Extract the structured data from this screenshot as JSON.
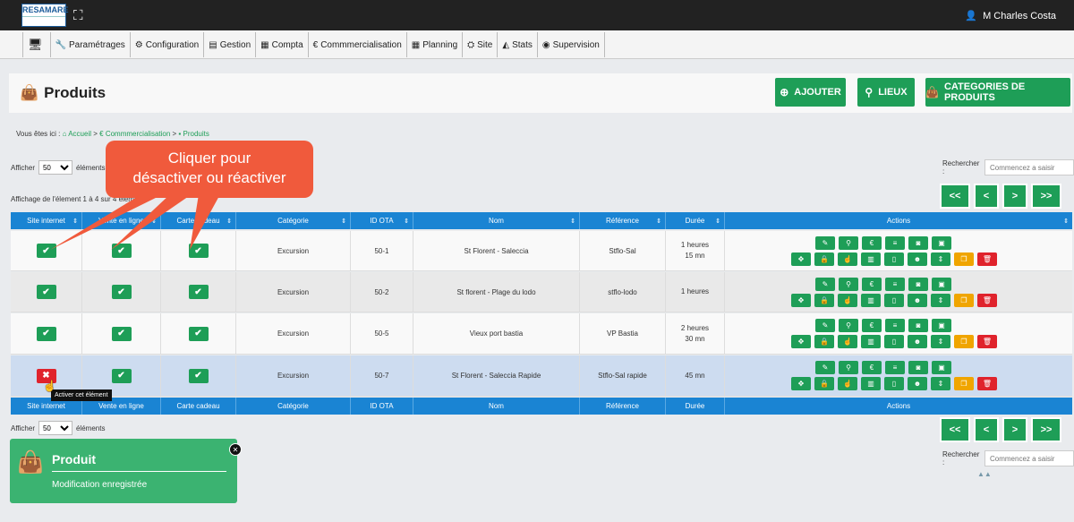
{
  "app": {
    "logo_text": "RESAMARE",
    "user": "M Charles Costa"
  },
  "menu": [
    "Paramétrages",
    "Configuration",
    "Gestion",
    "Compta",
    "Commmercialisation",
    "Planning",
    "Site",
    "Stats",
    "Supervision"
  ],
  "page": {
    "title": "Produits"
  },
  "buttons": {
    "add": "AJOUTER",
    "places": "LIEUX",
    "categories": "CATEGORIES DE PRODUITS"
  },
  "breadcrumb": {
    "prefix": "Vous êtes ici :",
    "home": "Accueil",
    "section": "Commmercialisation",
    "current": "Produits"
  },
  "list": {
    "show_label": "Afficher",
    "page_size": "50",
    "items_label": "éléments",
    "search_label": "Rechercher :",
    "search_placeholder": "Commencez a saisir",
    "info": "Affichage de l'élement 1 à 4 sur 4 éléments"
  },
  "pager": {
    "first": "<<",
    "prev": "<",
    "next": ">",
    "last": ">>"
  },
  "columns": [
    "Site internet",
    "Vente en ligne",
    "Carte cadeau",
    "Catégorie",
    "ID OTA",
    "Nom",
    "Référence",
    "Durée",
    "Actions"
  ],
  "rows": [
    {
      "site": true,
      "vente": true,
      "carte": true,
      "categorie": "Excursion",
      "id": "50-1",
      "nom": "St Florent - Saleccia",
      "ref": "Stflo-Sal",
      "duree1": "1 heures",
      "duree2": "15 mn"
    },
    {
      "site": true,
      "vente": true,
      "carte": true,
      "categorie": "Excursion",
      "id": "50-2",
      "nom": "St florent - Plage du lodo",
      "ref": "stflo-lodo",
      "duree1": "1 heures",
      "duree2": ""
    },
    {
      "site": true,
      "vente": true,
      "carte": true,
      "categorie": "Excursion",
      "id": "50-5",
      "nom": "Vieux port bastia",
      "ref": "VP Bastia",
      "duree1": "2 heures",
      "duree2": "30 mn"
    },
    {
      "site": false,
      "vente": true,
      "carte": true,
      "categorie": "Excursion",
      "id": "50-7",
      "nom": "St Florent - Saleccia Rapide",
      "ref": "Stflo-Sal rapide",
      "duree1": "45 mn",
      "duree2": ""
    }
  ],
  "tooltip": "Activer cet élément",
  "callout": {
    "line1": "Cliquer pour",
    "line2": "désactiver ou réactiver"
  },
  "toast": {
    "title": "Produit",
    "message": "Modification enregistrée"
  },
  "colors": {
    "green": "#1e9e57",
    "blue": "#1a84d3",
    "red": "#e0232c",
    "orange": "#f0a500",
    "callout": "#f05a3c"
  }
}
